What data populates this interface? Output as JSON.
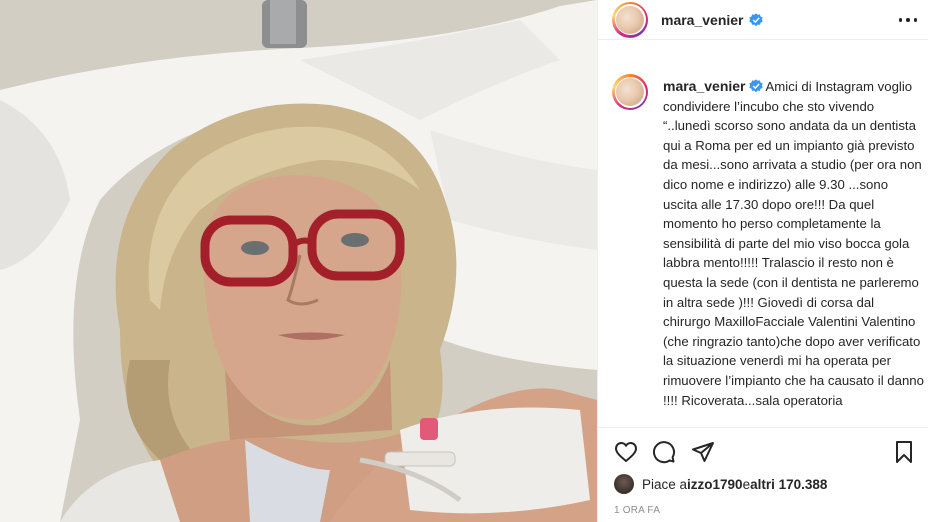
{
  "header": {
    "username": "mara_venier",
    "verified_icon": "verified-badge-icon",
    "more_icon": "more-options-icon"
  },
  "caption": {
    "username": "mara_venier",
    "text": "Amici di Instagram voglio condividere l’incubo che sto vivendo “..lunedì scorso sono andata da un dentista qui a Roma per ed un impianto già previsto da mesi...sono arrivata a studio (per ora non dico nome e indirizzo) alle 9.30 ...sono uscita alle 17.30 dopo ore!!! Da quel momento ho perso completamente la sensibilità di parte del mio viso bocca gola labbra mento!!!!! Tralascio il resto non è questa la sede (con il dentista ne parleremo in altra sede )!!! Giovedì di corsa dal chirurgo MaxilloFacciale Valentini Valentino (che ringrazio tanto)che dopo aver verificato la situazione venerdì mi ha operata per rimuovere l’impianto che ha causato il danno !!!! Ricoverata...sala operatoria"
  },
  "actions": {
    "like_icon": "heart-icon",
    "comment_icon": "comment-icon",
    "share_icon": "share-icon",
    "save_icon": "bookmark-icon"
  },
  "likes": {
    "prefix": "Piace a ",
    "user": "izzo1790",
    "middle": " e ",
    "others": "altri 170.388"
  },
  "timestamp": "1 ORA FA",
  "colors": {
    "text": "#262626",
    "verified": "#3897f0",
    "muted": "#8e8e8e",
    "border": "#efefef"
  }
}
